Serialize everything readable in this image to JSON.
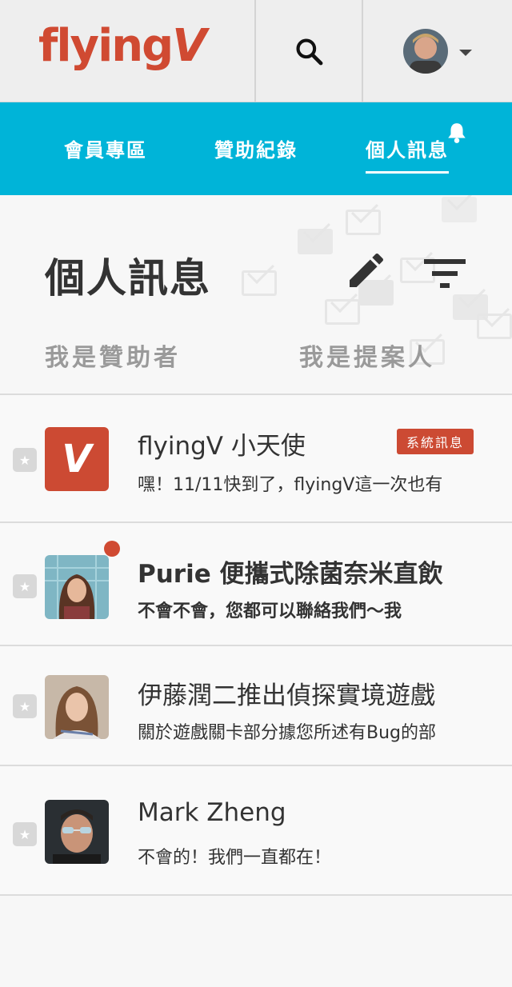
{
  "brand": {
    "logo_main": "flying",
    "logo_v": "V"
  },
  "nav": {
    "items": [
      {
        "label": "會員專區"
      },
      {
        "label": "贊助紀錄"
      },
      {
        "label": "個人訊息"
      }
    ],
    "active_index": 2
  },
  "header": {
    "title": "個人訊息",
    "tabs": [
      {
        "label": "我是贊助者"
      },
      {
        "label": "我是提案人"
      }
    ]
  },
  "messages": [
    {
      "title": "flyingV 小天使",
      "preview": "嘿！11/11快到了，flyingV這一次也有",
      "tag": "系統訊息",
      "unread": false,
      "avatar_glyph": "V"
    },
    {
      "title": "Purie 便攜式除菌奈米直飲",
      "preview": "不會不會，您都可以聯絡我們～我",
      "unread": true
    },
    {
      "title": "伊藤潤二推出偵探實境遊戲",
      "preview": "關於遊戲關卡部分據您所述有Bug的部",
      "unread": false
    },
    {
      "title": "Mark Zheng",
      "preview": "不會的！我們一直都在！",
      "unread": false
    }
  ],
  "colors": {
    "brand": "#d04a32",
    "nav_bg": "#00b4d8",
    "tag_bg": "#cc4a33"
  },
  "icons": [
    "search-icon",
    "caret-down-icon",
    "bell-icon",
    "edit-icon",
    "filter-icon",
    "star-icon",
    "mail-icon"
  ]
}
